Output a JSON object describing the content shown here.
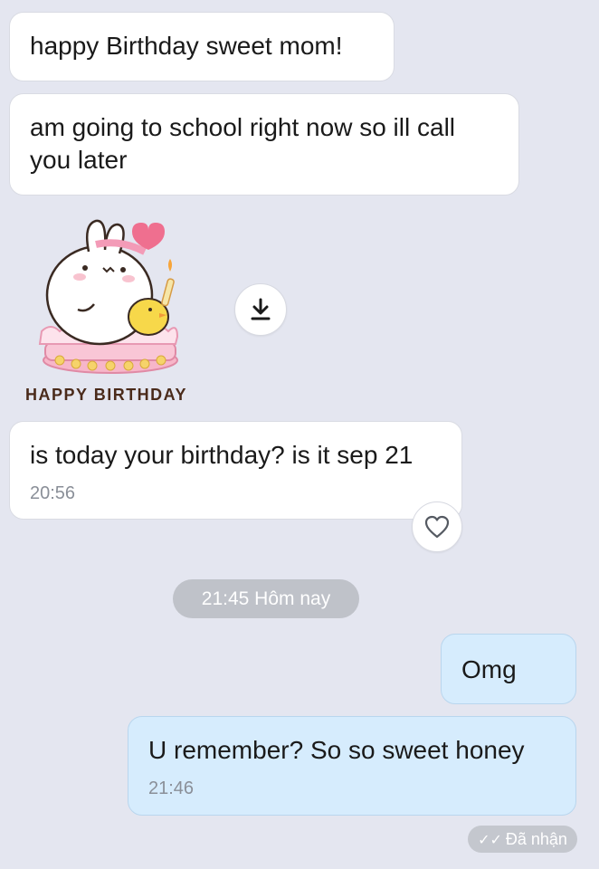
{
  "messages": {
    "m1": {
      "text": "happy Birthday sweet mom!"
    },
    "m2": {
      "text": "am going to school right now so ill call you later"
    },
    "sticker": {
      "label": "HAPPY BIRTHDAY"
    },
    "m3": {
      "text": "is today your birthday? is it sep 21",
      "time": "20:56"
    },
    "divider": {
      "text": "21:45 Hôm nay"
    },
    "m4": {
      "text": "Omg"
    },
    "m5": {
      "text": "U remember? So so sweet honey",
      "time": "21:46"
    }
  },
  "status": {
    "check": "✓✓",
    "text": "Đã nhận"
  },
  "icons": {
    "download": "download-icon",
    "heart": "heart-icon"
  },
  "colors": {
    "background": "#e4e6f0",
    "incoming": "#ffffff",
    "outgoing": "#d6ecfd"
  }
}
